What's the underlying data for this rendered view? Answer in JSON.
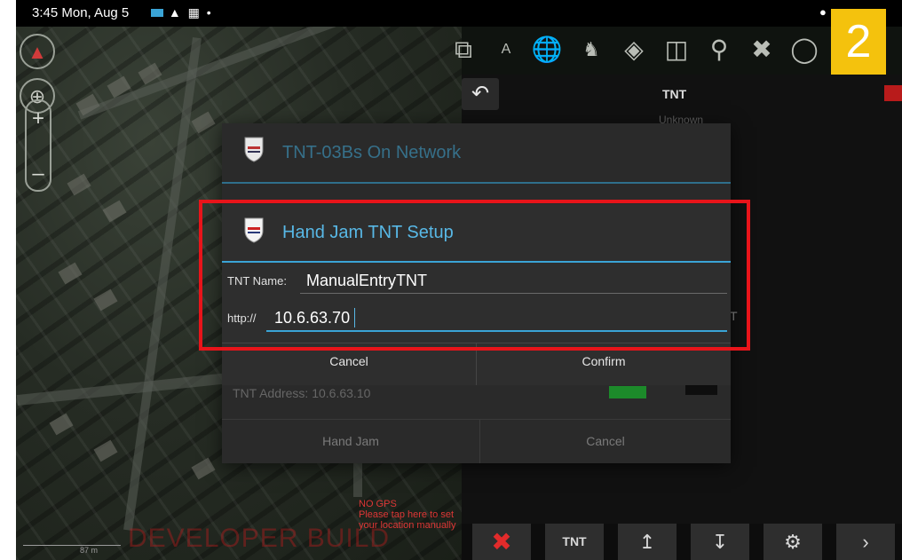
{
  "status_bar": {
    "time": "3:45",
    "date": "Mon, Aug 5",
    "icons": [
      "message-icon",
      "notification-icon",
      "calendar-icon",
      "dot-icon"
    ],
    "right_icons": [
      "location-icon",
      "wifi-icon"
    ]
  },
  "step_badge": {
    "number": "2",
    "color": "#f4c20d"
  },
  "toolbar": {
    "icons": [
      "expand-icon",
      "ruler-icon",
      "globe-icon",
      "contacts-icon",
      "layers-icon",
      "map-icon",
      "add-marker-icon",
      "close-tools-icon",
      "overflow-icon"
    ]
  },
  "right_panel": {
    "title": "TNT",
    "subtitle": "Unknown",
    "status_color": "#b81b1b"
  },
  "background_dialog": {
    "title": "TNT-03Bs On Network",
    "address_label": "TNT Address: 10.6.63.10",
    "buttons": {
      "hand_jam": "Hand Jam",
      "cancel": "Cancel"
    }
  },
  "setup_dialog": {
    "title": "Hand Jam TNT Setup",
    "name_label": "TNT Name:",
    "name_value": "ManualEntryTNT",
    "url_label": "http://",
    "url_value": "10.6.63.70",
    "buttons": {
      "cancel": "Cancel",
      "confirm": "Confirm"
    }
  },
  "bottom_bar": {
    "tnt_label": "TNT",
    "icons": [
      "cancel-x-icon",
      "upload-icon",
      "download-icon",
      "settings-icon",
      "next-icon"
    ]
  },
  "map_overlay": {
    "developer_build": "DEVELOPER BUILD",
    "no_gps": "NO GPS",
    "gps_hint": "Please tap here to set your location manually",
    "scale_label": "87 m"
  },
  "colors": {
    "accent": "#3aa4d6",
    "highlight": "#e8141a",
    "connected": "#1c8a2a"
  }
}
